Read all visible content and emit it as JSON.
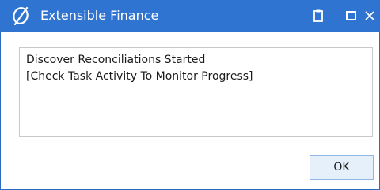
{
  "window": {
    "title": "Extensible Finance",
    "accent_color": "#2f74d0",
    "icons": [
      "app-logo-icon",
      "clipboard-icon",
      "maximize-icon",
      "close-icon"
    ]
  },
  "message": {
    "line1": "Discover Reconciliations Started",
    "line2": "[Check Task Activity To Monitor Progress]"
  },
  "buttons": {
    "ok_label": "OK"
  }
}
